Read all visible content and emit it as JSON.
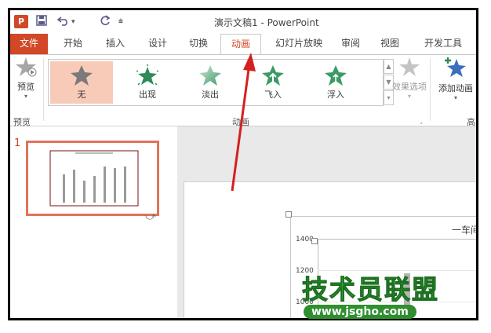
{
  "app": {
    "logo_text": "P",
    "window_title": "演示文稿1 - PowerPoint",
    "qat_icons": [
      "save-icon",
      "undo-icon",
      "redo-icon",
      "customize-icon"
    ]
  },
  "tabs": [
    {
      "label": "文件"
    },
    {
      "label": "开始"
    },
    {
      "label": "插入"
    },
    {
      "label": "设计"
    },
    {
      "label": "切换"
    },
    {
      "label": "动画"
    },
    {
      "label": "幻灯片放映"
    },
    {
      "label": "审阅"
    },
    {
      "label": "视图"
    },
    {
      "label": "开发工具"
    }
  ],
  "active_tab": "动画",
  "ribbon": {
    "preview_label": "预览",
    "preview_group_label": "预览",
    "animation_group_label": "动画",
    "advanced_group_label": "高",
    "gallery": [
      {
        "label": "无",
        "icon": "star-gray-icon"
      },
      {
        "label": "出现",
        "icon": "star-burst-icon"
      },
      {
        "label": "淡出",
        "icon": "star-fade-icon"
      },
      {
        "label": "飞入",
        "icon": "star-fly-icon"
      },
      {
        "label": "浮入",
        "icon": "star-float-icon"
      }
    ],
    "effect_options_label": "效果选项",
    "add_animation_label": "添加动画"
  },
  "thumbnail": {
    "number": "1"
  },
  "slide": {
    "chart_title_partial": "一车间",
    "y_ticks": [
      "1400",
      "1200",
      "1000"
    ]
  },
  "chart_data": {
    "type": "bar",
    "title": "一车间",
    "yticks": [
      1000,
      1200,
      1400
    ]
  },
  "watermark": {
    "main": "技术员联盟",
    "url": "www.jsgho.com"
  },
  "colors": {
    "accent": "#d24726",
    "selected": "#f8cbb8",
    "arrow": "#d42020"
  }
}
